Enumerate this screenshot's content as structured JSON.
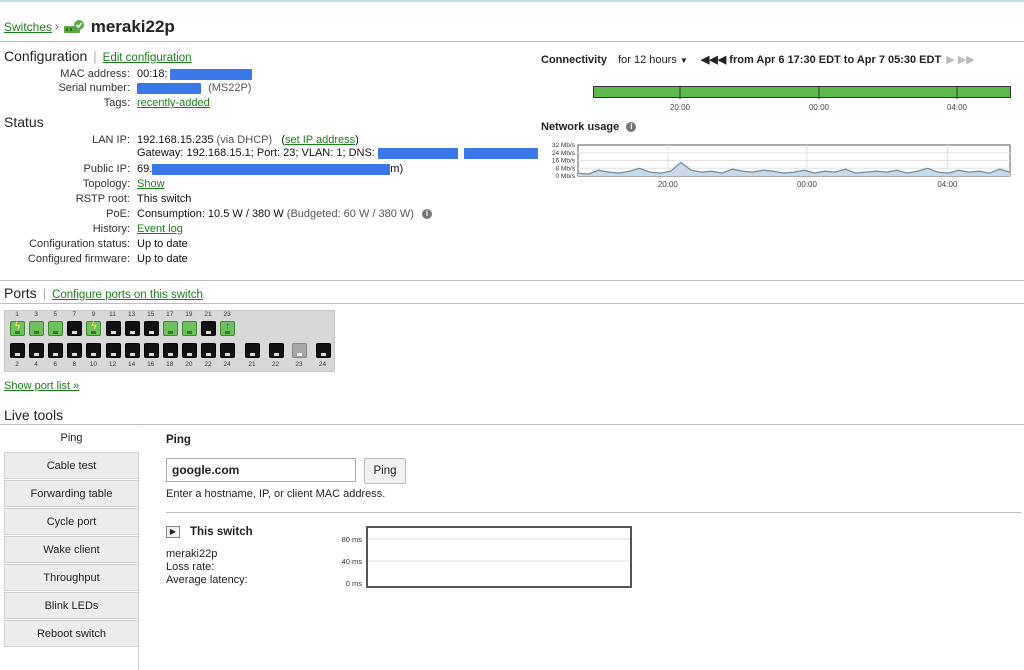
{
  "header": {
    "breadcrumb": "Switches",
    "breadcrumb_sep": "›",
    "device_name": "meraki22p"
  },
  "configuration": {
    "title": "Configuration",
    "edit_link": "Edit configuration",
    "mac_label": "MAC address:",
    "mac_value": "00:18:",
    "serial_label": "Serial number:",
    "serial_model": "(MS22P)",
    "tags_label": "Tags:",
    "tags_value": "recently-added"
  },
  "status": {
    "title": "Status",
    "lan_ip_label": "LAN IP:",
    "lan_ip_value": "192.168.15.235",
    "lan_ip_via": "(via DHCP)",
    "set_ip_link": "set IP address",
    "lan_ip_close": ")",
    "gateway_line": "Gateway: 192.168.15.1; Port: 23; VLAN: 1; DNS:",
    "public_ip_label": "Public IP:",
    "public_ip_value": "69.",
    "public_ip_tail": "m)",
    "topology_label": "Topology:",
    "topology_link": "Show",
    "rstp_label": "RSTP root:",
    "rstp_value": "This switch",
    "poe_label": "PoE:",
    "poe_value": "Consumption: 10.5 W / 380 W",
    "poe_budget": "(Budgeted: 60 W / 380 W)",
    "history_label": "History:",
    "history_link": "Event log",
    "config_status_label": "Configuration status:",
    "config_status_value": "Up to date",
    "firmware_label": "Configured firmware:",
    "firmware_value": "Up to date"
  },
  "connectivity": {
    "title": "Connectivity",
    "range_select": "for 12 hours",
    "range_text": "from Apr 6 17:30 EDT to Apr 7 05:30 EDT",
    "bar_color": "#5fb84c",
    "tick_labels": [
      "20:00",
      "00:00",
      "04:00"
    ]
  },
  "network_usage": {
    "title": "Network usage",
    "y_labels": [
      "32 Mb/s",
      "24 Mb/s",
      "16 Mb/s",
      "8 Mb/s",
      "0 Mb/s"
    ],
    "x_labels": [
      "20:00",
      "00:00",
      "04:00"
    ],
    "series_values_mbps": [
      3,
      2,
      6,
      4,
      3,
      5,
      8,
      4,
      3,
      5,
      14,
      6,
      4,
      5,
      3,
      7,
      5,
      4,
      6,
      5,
      3,
      4,
      6,
      3,
      5,
      4,
      7,
      3,
      4,
      5,
      4,
      6,
      3,
      5,
      8,
      4,
      3,
      6,
      4,
      5,
      3,
      7,
      4
    ]
  },
  "ports": {
    "title": "Ports",
    "configure_link": "Configure ports on this switch",
    "top_numbers": [
      "1",
      "3",
      "5",
      "7",
      "9",
      "11",
      "13",
      "15",
      "17",
      "19",
      "21",
      "23"
    ],
    "bottom_numbers": [
      "2",
      "4",
      "6",
      "8",
      "10",
      "12",
      "14",
      "16",
      "18",
      "20",
      "22",
      "24"
    ],
    "uplink_numbers": [
      "21",
      "22",
      "23",
      "24"
    ],
    "top_states": [
      "green-poe",
      "green",
      "green",
      "black",
      "green-poe",
      "black",
      "black",
      "black",
      "green",
      "green",
      "black",
      "green-up"
    ],
    "bottom_states": [
      "black",
      "black",
      "black",
      "black",
      "black",
      "black",
      "black",
      "black",
      "black",
      "black",
      "black",
      "black"
    ],
    "uplink_states": [
      "black",
      "black",
      "grey",
      "black"
    ],
    "show_list_link": "Show port list »"
  },
  "live_tools": {
    "title": "Live tools",
    "menu": [
      "Ping",
      "Cable test",
      "Forwarding table",
      "Cycle port",
      "Wake client",
      "Throughput",
      "Blink LEDs",
      "Reboot switch"
    ],
    "active": "Ping",
    "ping": {
      "heading": "Ping",
      "input_value": "google.com",
      "button": "Ping",
      "hint": "Enter a hostname, IP, or client MAC address.",
      "result_title": "This switch",
      "result_name": "meraki22p",
      "loss_label": "Loss rate:",
      "latency_label": "Average latency:",
      "y_labels": [
        "80 ms",
        "40 ms",
        "0 ms"
      ]
    }
  }
}
